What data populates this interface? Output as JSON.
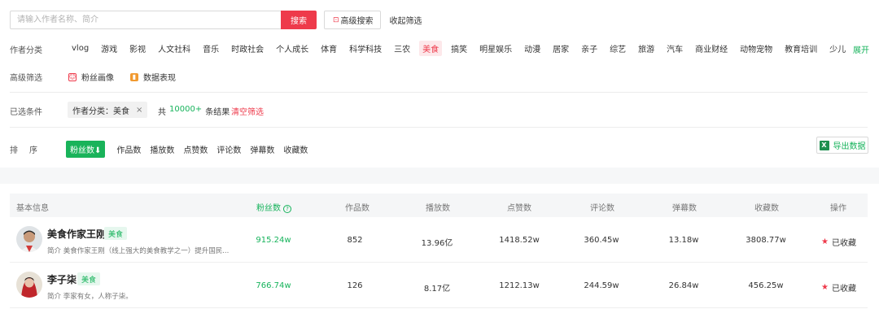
{
  "search": {
    "placeholder": "请输入作者名称、简介",
    "button": "搜索",
    "advanced": "高级搜索",
    "collapse": "收起筛选"
  },
  "categories": {
    "label": "作者分类",
    "items": [
      "vlog",
      "游戏",
      "影视",
      "人文社科",
      "音乐",
      "时政社会",
      "个人成长",
      "体育",
      "科学科技",
      "三农",
      "美食",
      "搞笑",
      "明星娱乐",
      "动漫",
      "居家",
      "亲子",
      "综艺",
      "旅游",
      "汽车",
      "商业财经",
      "动物宠物",
      "教育培训",
      "少儿"
    ],
    "active": "美食",
    "expand": "展开"
  },
  "advanced_filter": {
    "label": "高级筛选",
    "fans_profile": "粉丝画像",
    "data_performance": "数据表现"
  },
  "selected": {
    "label": "已选条件",
    "tag": "作者分类：美食",
    "close": "×",
    "result_prefix": "共",
    "result_count": "10000+",
    "result_suffix": "条结果",
    "clear": "清空筛选"
  },
  "sort": {
    "label": "排序",
    "active": "粉丝数",
    "active_arrow": "⬇",
    "items": [
      "作品数",
      "播放数",
      "点赞数",
      "评论数",
      "弹幕数",
      "收藏数"
    ],
    "export": "导出数据",
    "export_icon": "X"
  },
  "table": {
    "headers": {
      "basic": "基本信息",
      "fans": "粉丝数",
      "works": "作品数",
      "plays": "播放数",
      "likes": "点赞数",
      "comments": "评论数",
      "danmaku": "弹幕数",
      "collects": "收藏数",
      "action": "操作"
    },
    "rows": [
      {
        "name": "美食作家王刚",
        "tag": "美食",
        "intro": "简介 美食作家王刚（线上强大的美食教学之一）提升国民...",
        "fans": "915.24w",
        "works": "852",
        "plays": "13.96亿",
        "likes": "1418.52w",
        "comments": "360.45w",
        "danmaku": "13.18w",
        "collects": "3808.77w",
        "action": "已收藏"
      },
      {
        "name": "李子柒",
        "tag": "美食",
        "intro": "简介 李家有女，人称子柒。",
        "fans": "766.74w",
        "works": "126",
        "plays": "8.17亿",
        "likes": "1212.13w",
        "comments": "244.59w",
        "danmaku": "26.84w",
        "collects": "456.25w",
        "action": "已收藏"
      }
    ]
  },
  "colors": {
    "accent_red": "#ee3a4b",
    "accent_green": "#16b35b"
  }
}
